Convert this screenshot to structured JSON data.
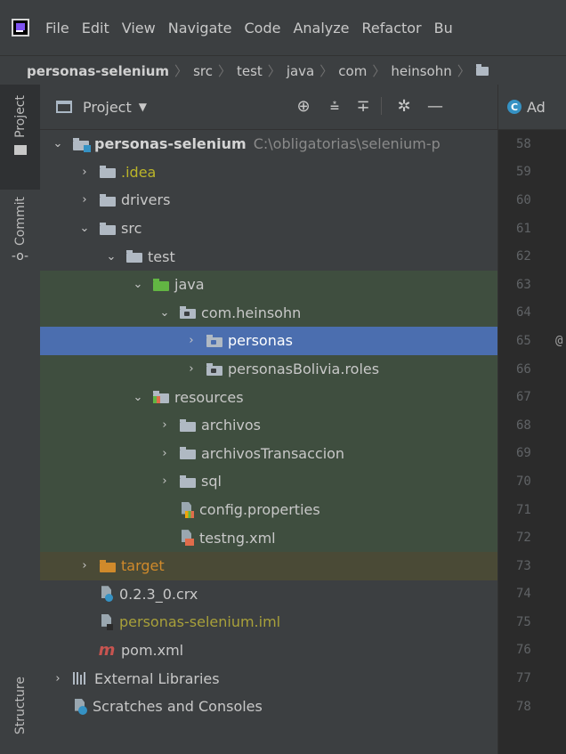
{
  "menubar": {
    "items": [
      "File",
      "Edit",
      "View",
      "Navigate",
      "Code",
      "Analyze",
      "Refactor",
      "Bu"
    ]
  },
  "breadcrumb": {
    "items": [
      "personas-selenium",
      "src",
      "test",
      "java",
      "com",
      "heinsohn"
    ]
  },
  "sidebar": {
    "project_label": "Project",
    "commit_label": "Commit",
    "structure_label": "Structure"
  },
  "panel": {
    "title": "Project",
    "title_arrow": "▼"
  },
  "tree": {
    "root": {
      "name": "personas-selenium",
      "path": "C:\\obligatorias\\selenium-p"
    },
    "idea": ".idea",
    "drivers": "drivers",
    "src": "src",
    "test": "test",
    "java": "java",
    "com_heinsohn": "com.heinsohn",
    "personas": "personas",
    "personasBolivia": "personasBolivia.roles",
    "resources": "resources",
    "archivos": "archivos",
    "archivosTransaccion": "archivosTransaccion",
    "sql": "sql",
    "config": "config.properties",
    "testng": "testng.xml",
    "target": "target",
    "crx": "0.2.3_0.crx",
    "iml": "personas-selenium.iml",
    "pom": "pom.xml",
    "external_libraries": "External Libraries",
    "scratches": "Scratches and Consoles"
  },
  "editor": {
    "tab_label": "Ad",
    "tab_icon_letter": "C",
    "line_numbers": [
      "58",
      "59",
      "60",
      "61",
      "62",
      "63",
      "64",
      "65",
      "66",
      "67",
      "68",
      "69",
      "70",
      "71",
      "72",
      "73",
      "74",
      "75",
      "76",
      "77",
      "78"
    ],
    "marker": "@"
  },
  "icons": {
    "locate": "crosshair-icon",
    "expand_all": "expand-all-icon",
    "collapse_all": "collapse-all-icon",
    "settings": "gear-icon",
    "hide": "minimize-icon"
  },
  "colors": {
    "selection": "#4b6eaf",
    "test_root_bg": "#3f4e3f",
    "excluded_bg": "#4a4a36",
    "idea_text": "#bbb529",
    "target_text": "#d08a2b"
  }
}
